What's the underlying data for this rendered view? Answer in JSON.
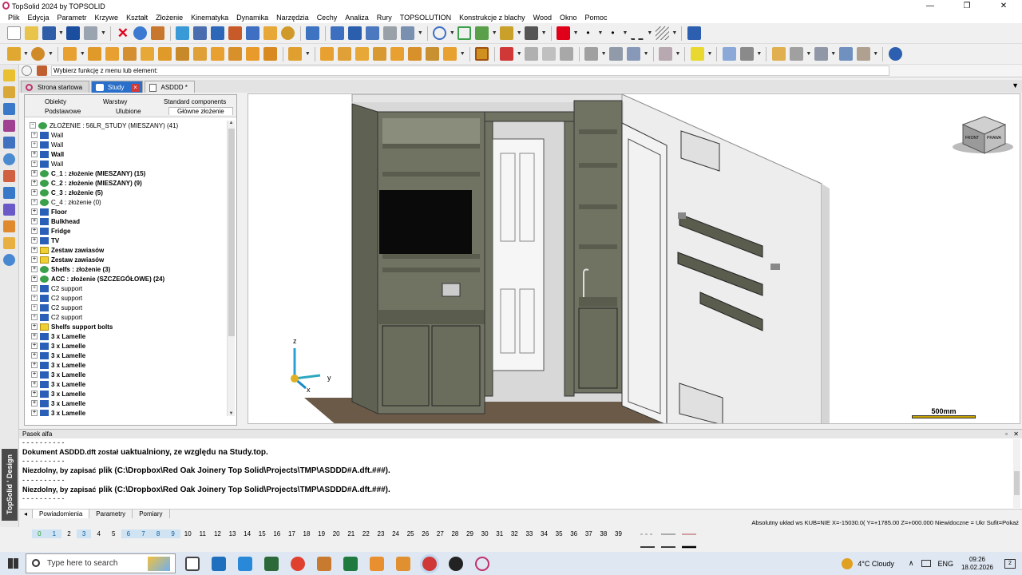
{
  "window": {
    "title": "TopSolid 2024 by TOPSOLID",
    "minimize": "—",
    "maximize": "❐",
    "close": "✕"
  },
  "menu": [
    "Plik",
    "Edycja",
    "Parametr",
    "Krzywe",
    "Kształt",
    "Złożenie",
    "Kinematyka",
    "Dynamika",
    "Narzędzia",
    "Cechy",
    "Analiza",
    "Rury",
    "TOPSOLUTION",
    "Konstrukcje z blachy",
    "Wood",
    "Okno",
    "Pomoc"
  ],
  "command_bar": {
    "prompt": "Wybierz funkcję z menu lub element:"
  },
  "doc_tabs": [
    {
      "label": "Strona startowa",
      "active": false
    },
    {
      "label": "Study",
      "active": true
    },
    {
      "label": "ASDDD *",
      "active": false
    }
  ],
  "tree_tabs": {
    "row1": [
      "Obiekty",
      "Warstwy",
      "Standard components"
    ],
    "row2": [
      "Podstawowe",
      "Ulubione",
      "Główne złożenie"
    ]
  },
  "tree": [
    {
      "label": "ZŁOŻENIE : 56LR_STUDY (MIESZANY) (41)",
      "bold": false,
      "icon": "assembly",
      "root": true
    },
    {
      "label": "Wall",
      "bold": false,
      "icon": "part"
    },
    {
      "label": "Wall",
      "bold": false,
      "icon": "part"
    },
    {
      "label": "Wall",
      "bold": true,
      "icon": "part"
    },
    {
      "label": "Wall",
      "bold": false,
      "icon": "part"
    },
    {
      "label": "C_1 : złożenie (MIESZANY) (15)",
      "bold": true,
      "icon": "assembly"
    },
    {
      "label": "C_2 : złożenie (MIESZANY) (9)",
      "bold": true,
      "icon": "assembly"
    },
    {
      "label": "C_3 : złożenie (5)",
      "bold": true,
      "icon": "assembly"
    },
    {
      "label": "C_4 : złożenie (0)",
      "bold": false,
      "icon": "assembly"
    },
    {
      "label": "Floor",
      "bold": true,
      "icon": "part"
    },
    {
      "label": "Bulkhead",
      "bold": true,
      "icon": "part"
    },
    {
      "label": "Fridge",
      "bold": true,
      "icon": "part"
    },
    {
      "label": "TV",
      "bold": true,
      "icon": "part"
    },
    {
      "label": "Zestaw zawiasów",
      "bold": true,
      "icon": "folder"
    },
    {
      "label": "Zestaw zawiasów",
      "bold": true,
      "icon": "folder"
    },
    {
      "label": "Shelfs : złożenie (3)",
      "bold": true,
      "icon": "assembly"
    },
    {
      "label": "ACC : złożenie (SZCZEGÓŁOWE) (24)",
      "bold": true,
      "icon": "assembly"
    },
    {
      "label": "C2 support",
      "bold": false,
      "icon": "part"
    },
    {
      "label": "C2 support",
      "bold": false,
      "icon": "part"
    },
    {
      "label": "C2 support",
      "bold": false,
      "icon": "part"
    },
    {
      "label": "C2 support",
      "bold": false,
      "icon": "part"
    },
    {
      "label": "Shelfs support bolts",
      "bold": true,
      "icon": "folder"
    },
    {
      "label": "3 x Lamelle",
      "bold": true,
      "icon": "part"
    },
    {
      "label": "3 x Lamelle",
      "bold": true,
      "icon": "part"
    },
    {
      "label": "3 x Lamelle",
      "bold": true,
      "icon": "part"
    },
    {
      "label": "3 x Lamelle",
      "bold": true,
      "icon": "part"
    },
    {
      "label": "3 x Lamelle",
      "bold": true,
      "icon": "part"
    },
    {
      "label": "3 x Lamelle",
      "bold": true,
      "icon": "part"
    },
    {
      "label": "3 x Lamelle",
      "bold": true,
      "icon": "part"
    },
    {
      "label": "3 x Lamelle",
      "bold": true,
      "icon": "part"
    },
    {
      "label": "3 x Lamelle",
      "bold": true,
      "icon": "part"
    }
  ],
  "viewport": {
    "scale_label": "500mm",
    "axes": {
      "x": "x",
      "y": "y",
      "z": "z"
    },
    "viewcube": {
      "front": "FRONT",
      "right": "PRAWA"
    }
  },
  "alpha_panel": {
    "title": "Pasek alfa",
    "lines": [
      {
        "text": "- - - - - - - - - -",
        "kind": "sep"
      },
      {
        "small": "Dokument ASDDD.dft został",
        "big": "uaktualniony, ze względu na Study.top."
      },
      {
        "text": "- - - - - - - - - -",
        "kind": "sep"
      },
      {
        "small": "Niezdolny, by zapisać",
        "big": "plik (C:\\Dropbox\\Red Oak Joinery Top Solid\\Projects\\TMP\\ASDDD#A.dft.###)."
      },
      {
        "text": "- - - - - - - - - -",
        "kind": "sep"
      },
      {
        "small": "Niezdolny, by zapisać",
        "big": "plik (C:\\Dropbox\\Red Oak Joinery Top Solid\\Projects\\TMP\\ASDDD#A.dft.###)."
      },
      {
        "text": "- - - - - - - - - -",
        "kind": "sep"
      }
    ],
    "tabs": [
      "Powiadomienia",
      "Parametry",
      "Pomiary"
    ]
  },
  "status": "Absolutny układ ws KUB=NIE  X=-15030.0( Y=+1785.00  Z=+000.000 Niewidoczne = Ukr  Sufit=Pokaż",
  "layers": [
    {
      "n": "0",
      "h": true
    },
    {
      "n": "1",
      "h": true
    },
    {
      "n": "2",
      "h": false
    },
    {
      "n": "3",
      "h": true
    },
    {
      "n": "4",
      "h": false
    },
    {
      "n": "5",
      "h": false
    },
    {
      "n": "6",
      "h": true
    },
    {
      "n": "7",
      "h": true
    },
    {
      "n": "8",
      "h": true
    },
    {
      "n": "9",
      "h": true
    },
    {
      "n": "10",
      "h": false
    },
    {
      "n": "11",
      "h": false
    },
    {
      "n": "12",
      "h": false
    },
    {
      "n": "13",
      "h": false
    },
    {
      "n": "14",
      "h": false
    },
    {
      "n": "15",
      "h": false
    },
    {
      "n": "16",
      "h": false
    },
    {
      "n": "17",
      "h": false
    },
    {
      "n": "18",
      "h": false
    },
    {
      "n": "19",
      "h": false
    },
    {
      "n": "20",
      "h": false
    },
    {
      "n": "21",
      "h": false
    },
    {
      "n": "22",
      "h": false
    },
    {
      "n": "23",
      "h": false
    },
    {
      "n": "24",
      "h": false
    },
    {
      "n": "25",
      "h": false
    },
    {
      "n": "26",
      "h": false
    },
    {
      "n": "27",
      "h": false
    },
    {
      "n": "28",
      "h": false
    },
    {
      "n": "29",
      "h": false
    },
    {
      "n": "30",
      "h": false
    },
    {
      "n": "31",
      "h": false
    },
    {
      "n": "32",
      "h": false
    },
    {
      "n": "33",
      "h": false
    },
    {
      "n": "34",
      "h": false
    },
    {
      "n": "35",
      "h": false
    },
    {
      "n": "36",
      "h": false
    },
    {
      "n": "37",
      "h": false
    },
    {
      "n": "38",
      "h": false
    },
    {
      "n": "39",
      "h": false
    }
  ],
  "brand_vertical": "TopSolid ' Design",
  "taskbar": {
    "search_placeholder": "Type here to search",
    "weather": "4°C  Cloudy",
    "lang": "ENG",
    "time": "09:26",
    "date": "18.02.2026",
    "notif_count": "2"
  },
  "colors": {
    "accent": "#0078d7",
    "cabinet": "#6e7060",
    "tab_active": "#2a6fc9",
    "error_icon": "#e0001a"
  }
}
